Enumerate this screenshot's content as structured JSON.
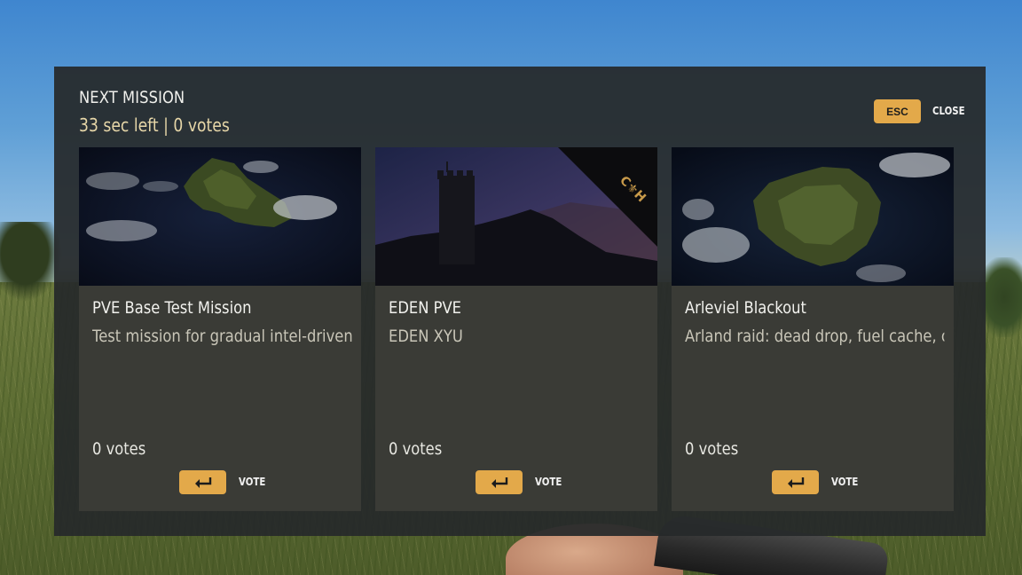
{
  "header": {
    "title": "NEXT MISSION",
    "status": "33 sec left | 0 votes"
  },
  "close_control": {
    "key_label": "ESC",
    "label": "CLOSE"
  },
  "missions": [
    {
      "name": "PVE Base Test Mission",
      "description": "Test mission for gradual intel-driven t",
      "votes": "0 votes",
      "vote_key_icon": "enter-key-icon",
      "vote_label": "VOTE",
      "thumbnail": "island-map-thumbnail"
    },
    {
      "name": "EDEN PVE",
      "description": "EDEN XYU",
      "votes": "0 votes",
      "vote_key_icon": "enter-key-icon",
      "vote_label": "VOTE",
      "thumbnail": "castle-at-dusk-thumbnail",
      "corner_banner_text": "C⚜H"
    },
    {
      "name": "Arleviel Blackout",
      "description": "Arland raid: dead drop, fuel cache, co",
      "votes": "0 votes",
      "vote_key_icon": "enter-key-icon",
      "vote_label": "VOTE",
      "thumbnail": "island-map-thumbnail"
    }
  ],
  "colors": {
    "accent": "#e3a94a",
    "panel_bg": "#26292a",
    "card_bg": "#3a3b36",
    "subtitle": "#e6d6a8",
    "text": "#f2f2ee"
  }
}
